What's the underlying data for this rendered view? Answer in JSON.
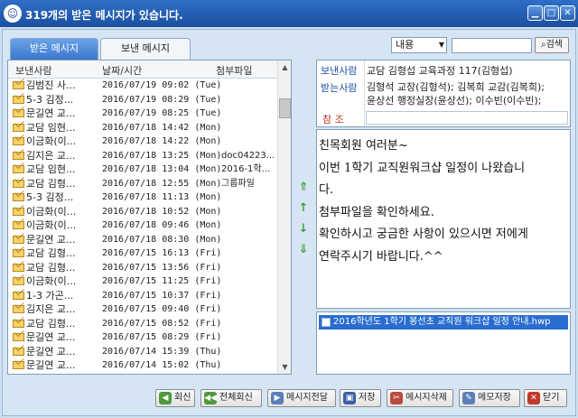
{
  "window": {
    "title": "319개의 받은 메시지가 있습니다.",
    "colors": {
      "titlebar": "#1b4f9e",
      "accent": "#3a78cf",
      "selection": "#2a6dd1",
      "arrow_green": "#3fa33b"
    }
  },
  "tabs": [
    {
      "label": "받은 메시지",
      "active": true
    },
    {
      "label": "보낸 메시지",
      "active": false
    }
  ],
  "list": {
    "headers": [
      "보낸사람",
      "날짜/시간",
      "첨부파일"
    ],
    "rows": [
      {
        "sender": "김범진 사...",
        "date": "2016/07/19 09:02 (Tue)",
        "attach": ""
      },
      {
        "sender": "5-3 김정...",
        "date": "2016/07/19 08:29 (Tue)",
        "attach": ""
      },
      {
        "sender": "문길연 교...",
        "date": "2016/07/19 08:25 (Tue)",
        "attach": ""
      },
      {
        "sender": "교담 임현...",
        "date": "2016/07/18 14:42 (Mon)",
        "attach": ""
      },
      {
        "sender": "이금화(이...",
        "date": "2016/07/18 14:22 (Mon)",
        "attach": ""
      },
      {
        "sender": "김지은 교...",
        "date": "2016/07/18 13:25 (Mon)",
        "attach": "doc04223..."
      },
      {
        "sender": "교담 임현...",
        "date": "2016/07/18 13:04 (Mon)",
        "attach": "2016-1학..."
      },
      {
        "sender": "교담 김형...",
        "date": "2016/07/18 12:55 (Mon)",
        "attach": "그룹파일"
      },
      {
        "sender": "5-3 김정...",
        "date": "2016/07/18 11:13 (Mon)",
        "attach": ""
      },
      {
        "sender": "이금화(이...",
        "date": "2016/07/18 10:52 (Mon)",
        "attach": ""
      },
      {
        "sender": "이금화(이...",
        "date": "2016/07/18 09:46 (Mon)",
        "attach": ""
      },
      {
        "sender": "문길연 교...",
        "date": "2016/07/18 08:30 (Mon)",
        "attach": ""
      },
      {
        "sender": "교담 김형...",
        "date": "2016/07/15 16:13 (Fri)",
        "attach": ""
      },
      {
        "sender": "교담 김형...",
        "date": "2016/07/15 13:56 (Fri)",
        "attach": ""
      },
      {
        "sender": "이금화(이...",
        "date": "2016/07/15 11:25 (Fri)",
        "attach": ""
      },
      {
        "sender": "1-3 가곤...",
        "date": "2016/07/15 10:37 (Fri)",
        "attach": ""
      },
      {
        "sender": "김지은 교...",
        "date": "2016/07/15 09:40 (Fri)",
        "attach": ""
      },
      {
        "sender": "교담 김형...",
        "date": "2016/07/15 08:52 (Fri)",
        "attach": ""
      },
      {
        "sender": "문길연 교...",
        "date": "2016/07/15 08:29 (Fri)",
        "attach": ""
      },
      {
        "sender": "문길연 교...",
        "date": "2016/07/14 15:39 (Thu)",
        "attach": ""
      },
      {
        "sender": "문길연 교...",
        "date": "2016/07/14 15:02 (Thu)",
        "attach": ""
      }
    ]
  },
  "search": {
    "select_value": "내용",
    "placeholder": "",
    "button_label": "검색"
  },
  "message": {
    "from_label": "보낸사람",
    "from_value": "교담 김형섭 교육과정 117(김형섭)",
    "to_label": "받는사람",
    "to_line1": "김형석 교장(김형석); 김복희 교감(김복희);",
    "to_line2": "윤상선 행정실장(윤상선); 이수빈(이수빈);",
    "cc_label": "참 조",
    "cc_value": "",
    "body": [
      "친목회원 여러분~",
      "이번 1학기 교직원워크샵 일정이 나왔습니",
      "다.",
      "첨부파일을 확인하세요.",
      "확인하시고 궁금한 사항이 있으시면 저에게",
      "연락주시기 바랍니다.^^"
    ],
    "attachment": "2016학년도 1학기 봉선초 교직원 워크샵 일정 안내.hwp"
  },
  "buttons": [
    {
      "label": "회신",
      "icon": "reply-icon"
    },
    {
      "label": "전체회신",
      "icon": "reply-all-icon"
    },
    {
      "label": "메시지전달",
      "icon": "forward-icon"
    },
    {
      "label": "저장",
      "icon": "save-icon"
    },
    {
      "label": "메시지삭제",
      "icon": "delete-icon"
    },
    {
      "label": "메모저장",
      "icon": "memo-save-icon"
    },
    {
      "label": "닫기",
      "icon": "close-icon"
    }
  ]
}
